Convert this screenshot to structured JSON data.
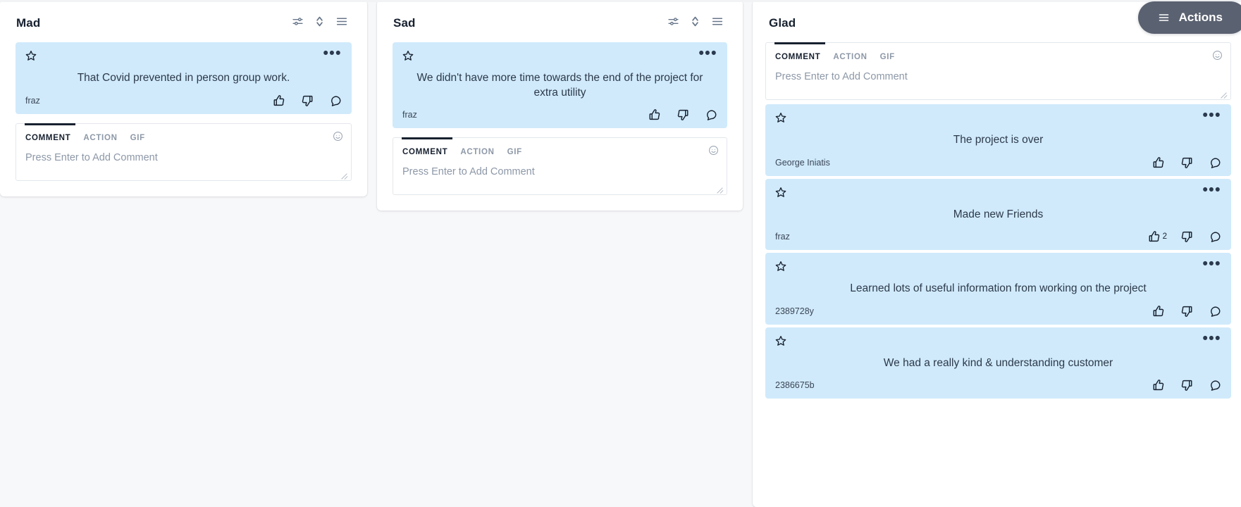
{
  "actions_button": {
    "label": "Actions",
    "icon": "hamburger-icon"
  },
  "header_icons": {
    "filter": "sliders-icon",
    "sort": "chevron-up-down-icon",
    "menu": "hamburger-icon"
  },
  "composer": {
    "tabs": [
      {
        "label": "COMMENT",
        "active": true
      },
      {
        "label": "ACTION",
        "active": false
      },
      {
        "label": "GIF",
        "active": false
      }
    ],
    "placeholder": "Press Enter to Add Comment",
    "smiley_icon": "smiley-icon"
  },
  "card_icons": {
    "star": "star-icon",
    "more": "more-options-icon",
    "like": "thumbs-up-icon",
    "dislike": "thumbs-down-icon",
    "comment": "comment-bubble-icon"
  },
  "colors": {
    "card_bg": "#d0eafb",
    "page_bg": "#f7f8fa",
    "actions_bg": "#5a6170",
    "text": "#2c3a4b"
  },
  "columns": [
    {
      "id": "mad",
      "title": "Mad",
      "cards": [
        {
          "text": "That Covid prevented in person group work.",
          "author": "fraz",
          "like_count": "",
          "dislike_count": ""
        }
      ]
    },
    {
      "id": "sad",
      "title": "Sad",
      "cards": [
        {
          "text": "We didn't have more time towards the end of the project for extra utility",
          "author": "fraz",
          "like_count": "",
          "dislike_count": ""
        }
      ]
    },
    {
      "id": "glad",
      "title": "Glad",
      "cards": [
        {
          "text": "The project is over",
          "author": "George Iniatis",
          "like_count": "",
          "dislike_count": ""
        },
        {
          "text": "Made new Friends",
          "author": "fraz",
          "like_count": "2",
          "dislike_count": ""
        },
        {
          "text": "Learned lots of useful information from working on the project",
          "author": "2389728y",
          "like_count": "",
          "dislike_count": ""
        },
        {
          "text": "We had a really kind & understanding customer",
          "author": "2386675b",
          "like_count": "",
          "dislike_count": ""
        }
      ]
    }
  ]
}
